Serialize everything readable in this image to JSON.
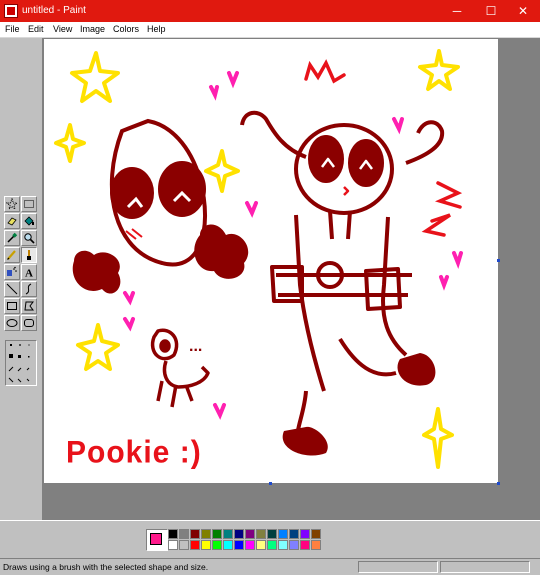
{
  "window": {
    "title": "untitled - Paint",
    "minimize_glyph": "─",
    "maximize_glyph": "☐",
    "close_glyph": "✕"
  },
  "menu": {
    "items": [
      "File",
      "Edit",
      "View",
      "Image",
      "Colors",
      "Help"
    ]
  },
  "toolbox": {
    "tools": [
      "free-form-select",
      "select",
      "eraser",
      "fill-with-color",
      "pick-color",
      "magnifier",
      "pencil",
      "brush",
      "airbrush",
      "text",
      "line",
      "curve",
      "rectangle",
      "polygon",
      "ellipse",
      "rounded-rectangle"
    ],
    "active_tool": "brush"
  },
  "drawing": {
    "caption": "Pookie :)",
    "ellipsis": "..."
  },
  "colors": {
    "foreground": "#ff1a8c",
    "background": "#ffffff",
    "ink": "#8b0000",
    "palette_top": [
      "#000000",
      "#808080",
      "#800000",
      "#808000",
      "#008000",
      "#008080",
      "#000080",
      "#800080",
      "#808040",
      "#004040",
      "#0080ff",
      "#004080",
      "#8000ff",
      "#804000"
    ],
    "palette_bottom": [
      "#ffffff",
      "#c0c0c0",
      "#ff0000",
      "#ffff00",
      "#00ff00",
      "#00ffff",
      "#0000ff",
      "#ff00ff",
      "#ffff80",
      "#00ff80",
      "#80ffff",
      "#8080ff",
      "#ff0080",
      "#ff8040"
    ]
  },
  "status": {
    "text": "Draws using a brush with the selected shape and size."
  }
}
